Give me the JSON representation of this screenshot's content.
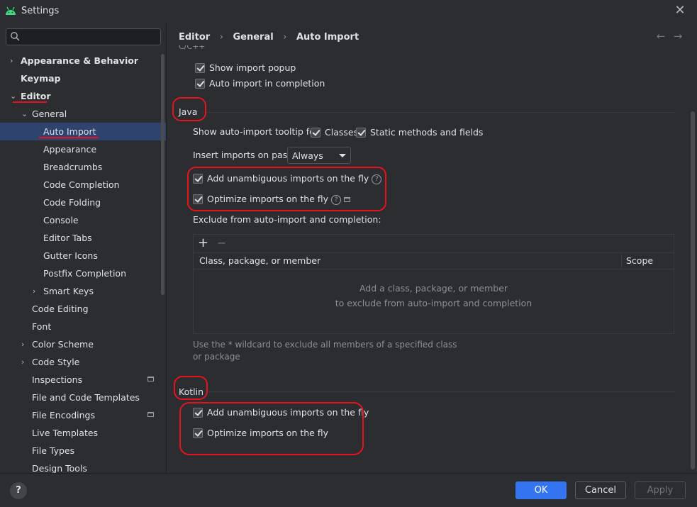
{
  "window": {
    "title": "Settings"
  },
  "search": {
    "placeholder": "",
    "value": ""
  },
  "sidebar": {
    "items": [
      {
        "label": "Appearance & Behavior",
        "arrow": "›"
      },
      {
        "label": "Keymap"
      },
      {
        "label": "Editor",
        "arrow": "⌄"
      },
      {
        "label": "General",
        "arrow": "⌄"
      },
      {
        "label": "Auto Import"
      },
      {
        "label": "Appearance"
      },
      {
        "label": "Breadcrumbs"
      },
      {
        "label": "Code Completion"
      },
      {
        "label": "Code Folding"
      },
      {
        "label": "Console"
      },
      {
        "label": "Editor Tabs"
      },
      {
        "label": "Gutter Icons"
      },
      {
        "label": "Postfix Completion"
      },
      {
        "label": "Smart Keys",
        "arrow": "›"
      },
      {
        "label": "Code Editing"
      },
      {
        "label": "Font"
      },
      {
        "label": "Color Scheme",
        "arrow": "›"
      },
      {
        "label": "Code Style",
        "arrow": "›"
      },
      {
        "label": "Inspections"
      },
      {
        "label": "File and Code Templates"
      },
      {
        "label": "File Encodings"
      },
      {
        "label": "Live Templates"
      },
      {
        "label": "File Types"
      },
      {
        "label": "Design Tools"
      }
    ]
  },
  "breadcrumb": {
    "part1": "Editor",
    "part2": "General",
    "part3": "Auto Import",
    "sep": "›"
  },
  "nav": {
    "back": "←",
    "forward": "→"
  },
  "cpp": {
    "cut_title": "C/C++",
    "show_import_popup": "Show import popup",
    "auto_import_completion": "Auto import in completion"
  },
  "java": {
    "title": "Java",
    "tooltip_label": "Show auto-import tooltip for:",
    "classes": "Classes",
    "static_methods": "Static methods and fields",
    "insert_label": "Insert imports on paste:",
    "insert_value": "Always",
    "add_unambiguous": "Add unambiguous imports on the fly",
    "optimize": "Optimize imports on the fly",
    "exclude_label": "Exclude from auto-import and completion:",
    "table": {
      "add": "+",
      "remove": "−",
      "col1": "Class, package, or member",
      "col2": "Scope",
      "empty_line1": "Add a class, package, or member",
      "empty_line2": "to exclude from auto-import and completion"
    },
    "hint": "Use the * wildcard to exclude all members of a specified class or package"
  },
  "kotlin": {
    "title": "Kotlin",
    "add_unambiguous": "Add unambiguous imports on the fly",
    "optimize": "Optimize imports on the fly"
  },
  "help_icon": "?",
  "buttons": {
    "ok": "OK",
    "cancel": "Cancel",
    "apply": "Apply"
  },
  "colors": {
    "accent": "#3574f0",
    "selection": "#2e436e",
    "annotation": "#e5131d"
  }
}
